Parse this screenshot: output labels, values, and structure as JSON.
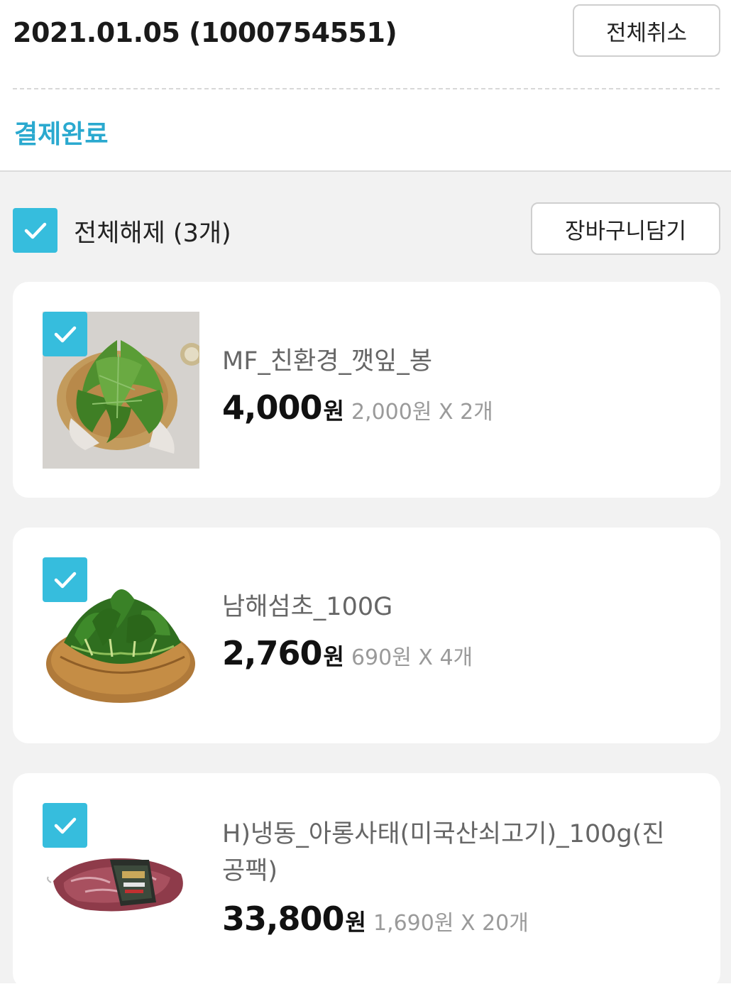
{
  "order": {
    "date_label": "2021.01.05 (1000754551)",
    "cancel_all_label": "전체취소",
    "status": "결제완료",
    "status_color": "#2aa9cf"
  },
  "selection": {
    "deselect_all_label": "전체해제 (3개)",
    "add_to_cart_label": "장바구니담기",
    "checkbox_color": "#36bddd"
  },
  "items": [
    {
      "name": "MF_친환경_깻잎_봉",
      "total": "4,000",
      "currency": "원",
      "unit_detail": "2,000원 X 2개",
      "checked": true,
      "image": "perilla-leaves-in-basket"
    },
    {
      "name": "남해섬초_100G",
      "total": "2,760",
      "currency": "원",
      "unit_detail": "690원 X 4개",
      "checked": true,
      "image": "spinach-in-basket"
    },
    {
      "name": "H)냉동_아롱사태(미국산쇠고기)_100g(진공팩)",
      "total": "33,800",
      "currency": "원",
      "unit_detail": "1,690원 X 20개",
      "checked": true,
      "image": "vacuum-packed-beef"
    }
  ]
}
